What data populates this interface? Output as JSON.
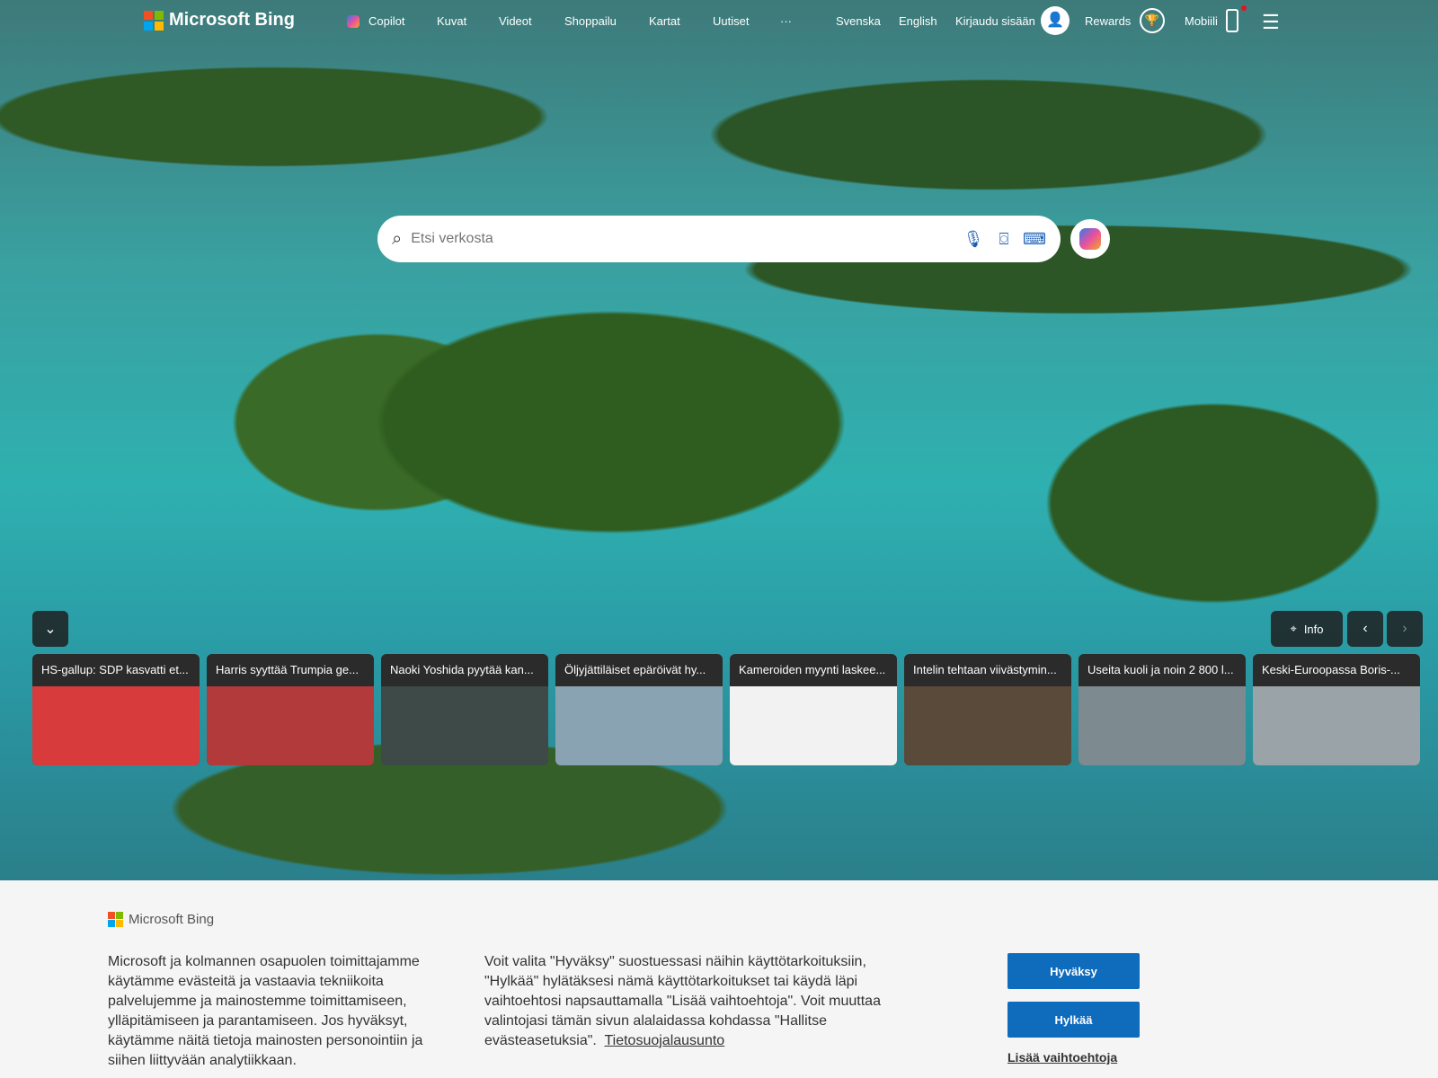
{
  "nav": {
    "brand": "Microsoft Bing",
    "items": [
      "Copilot",
      "Kuvat",
      "Videot",
      "Shoppailu",
      "Kartat",
      "Uutiset"
    ],
    "more": "···",
    "lang1": "Svenska",
    "lang2": "English",
    "signin": "Kirjaudu sisään",
    "rewards": "Rewards",
    "mobile": "Mobiili"
  },
  "search": {
    "placeholder": "Etsi verkosta"
  },
  "controls": {
    "info": "Info"
  },
  "news": [
    {
      "title": "HS-gallup: SDP kasvatti et...",
      "color": "#d83b3b"
    },
    {
      "title": "Harris syyttää Trumpia ge...",
      "color": "#b33a3a"
    },
    {
      "title": "Naoki Yoshida pyytää kan...",
      "color": "#3d4a48"
    },
    {
      "title": "Öljyjättiläiset epäröivät hy...",
      "color": "#8aa3b3"
    },
    {
      "title": "Kameroiden myynti laskee...",
      "color": "#f2f2f2"
    },
    {
      "title": "Intelin tehtaan viivästymin...",
      "color": "#5a4a3a"
    },
    {
      "title": "Useita kuoli ja noin 2 800 l...",
      "color": "#7d8a90"
    },
    {
      "title": "Keski-Euroopassa Boris-...",
      "color": "#9aa4a8"
    }
  ],
  "banner": {
    "brand": "Microsoft Bing",
    "text1": "Microsoft ja kolmannen osapuolen toimittajamme käytämme evästeitä ja vastaavia tekniikoita palvelujemme ja mainostemme toimittamiseen, ylläpitämiseen ja parantamiseen. Jos hyväksyt, käytämme näitä tietoja mainosten personointiin ja siihen liittyvään analytiikkaan.",
    "text2": "Voit valita \"Hyväksy\" suostuessasi näihin käyttötarkoituksiin, \"Hylkää\" hylätäksesi nämä käyttötarkoitukset tai käydä läpi vaihtoehtosi napsauttamalla \"Lisää vaihtoehtoja\". Voit muuttaa valintojasi tämän sivun alalaidassa kohdassa \"Hallitse evästeasetuksia\".",
    "privacy": "Tietosuojalausunto",
    "accept": "Hyväksy",
    "reject": "Hylkää",
    "more": "Lisää vaihtoehtoja"
  },
  "colors": {
    "accent": "#0f6cbd"
  }
}
